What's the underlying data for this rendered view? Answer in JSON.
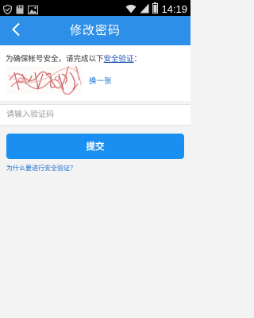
{
  "status_bar": {
    "time": "14:19",
    "left_icons": [
      "shield-icon",
      "sd-card-icon",
      "image-icon"
    ],
    "right_icons": [
      "wifi-icon",
      "signal-icon",
      "battery-icon"
    ]
  },
  "header": {
    "title": "修改密码",
    "back_icon": "chevron-left-icon",
    "background": "#2d8fe8"
  },
  "captcha": {
    "prompt_text": "为确保帐号安全，请完成以下",
    "prompt_link": "安全验证",
    "prompt_suffix": "：",
    "refresh_label": "换一张"
  },
  "input": {
    "placeholder": "请输入验证码",
    "value": ""
  },
  "submit": {
    "label": "提交",
    "color": "#1a8ff2"
  },
  "help": {
    "why_link": "为什么要进行安全验证？"
  }
}
